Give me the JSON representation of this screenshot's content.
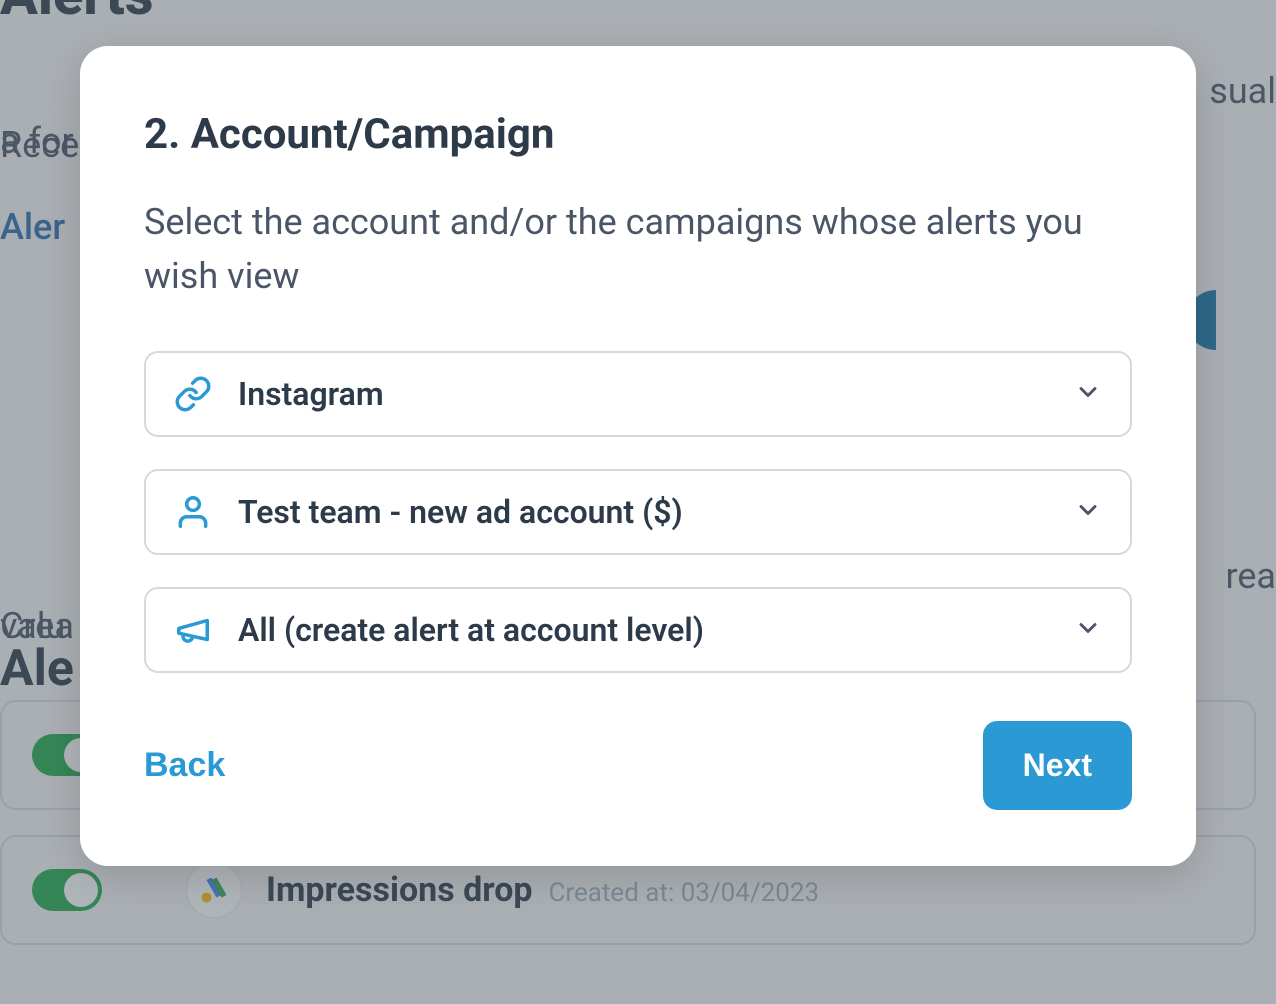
{
  "background": {
    "page_title": "Alerts",
    "intro_line1": "Receive email notification when something unusual",
    "intro_line2": "a for",
    "alerts_link": "Aler",
    "section_title": "Ale",
    "section_line1": "Crea",
    "section_line2": "valu",
    "section_suffix1": "sual",
    "section_suffix2": "rea",
    "card2_title": "Impressions drop",
    "card2_meta": "Created at: 03/04/2023"
  },
  "modal": {
    "title": "2. Account/Campaign",
    "description": "Select the account and/or the campaigns whose alerts you wish view",
    "fields": {
      "platform": {
        "label": "Instagram"
      },
      "account": {
        "label": "Test team - new ad account ($)"
      },
      "campaign": {
        "label": "All (create alert at account level)"
      }
    },
    "back_label": "Back",
    "next_label": "Next"
  }
}
